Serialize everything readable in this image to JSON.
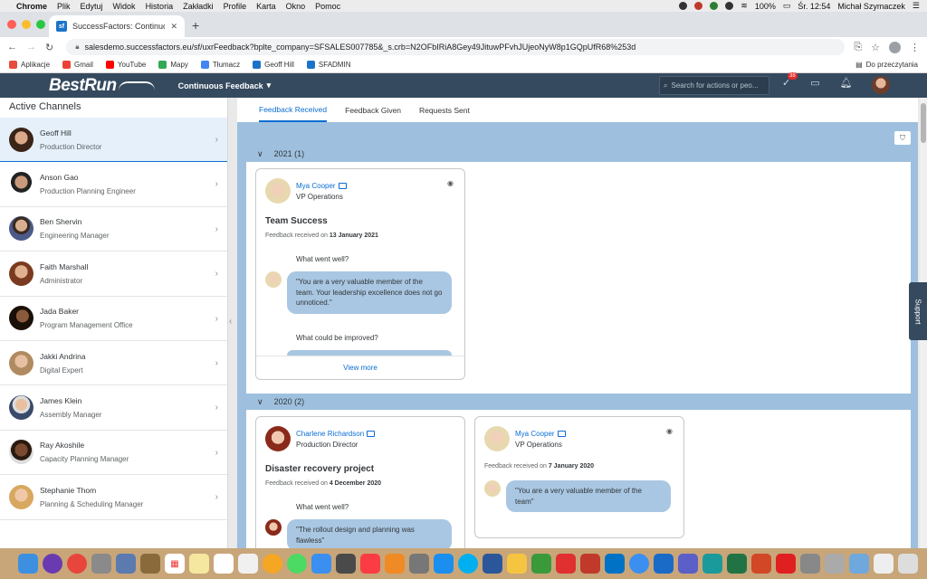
{
  "menubar": {
    "app": "Chrome",
    "items": [
      "Plik",
      "Edytuj",
      "Widok",
      "Historia",
      "Zakładki",
      "Profile",
      "Karta",
      "Okno",
      "Pomoc"
    ],
    "battery": "100%",
    "clock": "Śr. 12:54",
    "user": "Michał Szymaczek"
  },
  "browser": {
    "tab_title": "SuccessFactors: Continuous F…",
    "tab_favicon": "sf",
    "url": "salesdemo.successfactors.eu/sf/uxrFeedback?bplte_company=SFSALES007785&_s.crb=N2OFbIRiA8Gey49JituwPFvhJUjeoNyW8p1GQpUfR68%253d",
    "bookmarks": [
      "Aplikacje",
      "Gmail",
      "YouTube",
      "Mapy",
      "Tłumacz",
      "Geoff Hill",
      "SFADMIN"
    ],
    "reading_list": "Do przeczytania"
  },
  "shell": {
    "logo": "BestRun",
    "module": "Continuous Feedback",
    "search_placeholder": "Search for actions or peo...",
    "badge_count": "38",
    "support": "Support"
  },
  "left": {
    "title": "Active Channels",
    "channels": [
      {
        "name": "Geoff Hill",
        "role": "Production Director"
      },
      {
        "name": "Anson Gao",
        "role": "Production Planning Engineer"
      },
      {
        "name": "Ben Shervin",
        "role": "Engineering Manager"
      },
      {
        "name": "Faith Marshall",
        "role": "Administrator"
      },
      {
        "name": "Jada Baker",
        "role": "Program Management Office"
      },
      {
        "name": "Jakki Andrina",
        "role": "Digital Expert"
      },
      {
        "name": "James Klein",
        "role": "Assembly Manager"
      },
      {
        "name": "Ray Akoshile",
        "role": "Capacity Planning Manager"
      },
      {
        "name": "Stephanie Thom",
        "role": "Planning & Scheduling Manager"
      }
    ]
  },
  "main": {
    "tabs": [
      "Feedback Received",
      "Feedback Given",
      "Requests Sent"
    ],
    "groups": [
      {
        "label": "2021 (1)",
        "cards": [
          {
            "name": "Mya Cooper",
            "role": "VP Operations",
            "title": "Team Success",
            "date_prefix": "Feedback received on",
            "date": "13 January 2021",
            "q1": "What went well?",
            "a1": "\"You are a very valuable member of the team. Your leadership excellence does not go unnoticed.\"",
            "q2": "What could be improved?",
            "view_more": "View more"
          }
        ]
      },
      {
        "label": "2020 (2)",
        "cards": [
          {
            "name": "Charlene Richardson",
            "role": "Production Director",
            "title": "Disaster recovery project",
            "date_prefix": "Feedback received on",
            "date": "4 December 2020",
            "q1": "What went well?",
            "a1": "\"The rollout design and planning was flawless\""
          },
          {
            "name": "Mya Cooper",
            "role": "VP Operations",
            "date_prefix": "Feedback received on",
            "date": "7 January 2020",
            "a1": "\"You are a very valuable member of the team\""
          }
        ]
      }
    ]
  },
  "colors": {
    "shell": "#354a5f",
    "accent": "#0a6ed1",
    "canvas": "#9ec0de",
    "bubble": "#a9c7e2"
  }
}
